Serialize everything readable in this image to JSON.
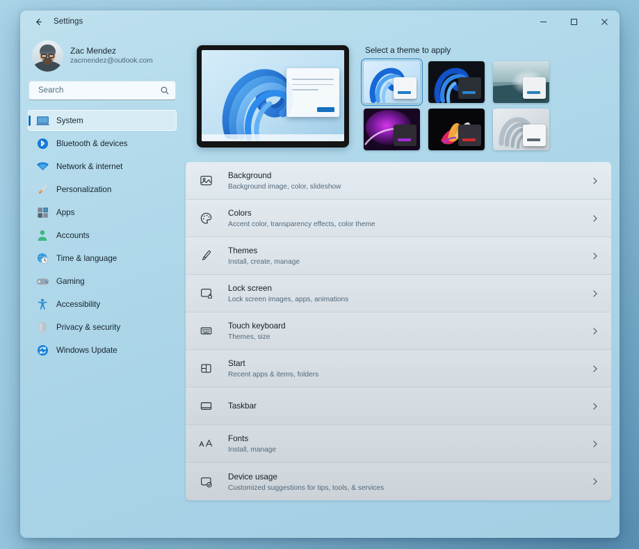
{
  "window": {
    "title": "Settings",
    "back_icon": "back-arrow-icon",
    "minimize_label": "—",
    "maximize_label": "□",
    "close_label": "✕"
  },
  "account": {
    "name": "Zac Mendez",
    "email": "zacmendez@outlook.com",
    "avatar_icon": "user-avatar-photo"
  },
  "search": {
    "placeholder": "Search",
    "value": "",
    "icon": "search-icon"
  },
  "sidebar": {
    "items": [
      {
        "label": "System",
        "icon": "system-monitor-icon",
        "selected": true
      },
      {
        "label": "Bluetooth & devices",
        "icon": "bluetooth-icon",
        "selected": false
      },
      {
        "label": "Network & internet",
        "icon": "wifi-icon",
        "selected": false
      },
      {
        "label": "Personalization",
        "icon": "paintbrush-icon",
        "selected": false
      },
      {
        "label": "Apps",
        "icon": "apps-grid-icon",
        "selected": false
      },
      {
        "label": "Accounts",
        "icon": "account-person-icon",
        "selected": false
      },
      {
        "label": "Time & language",
        "icon": "clock-globe-icon",
        "selected": false
      },
      {
        "label": "Gaming",
        "icon": "gamepad-icon",
        "selected": false
      },
      {
        "label": "Accessibility",
        "icon": "accessibility-person-icon",
        "selected": false
      },
      {
        "label": "Privacy & security",
        "icon": "shield-icon",
        "selected": false
      },
      {
        "label": "Windows Update",
        "icon": "update-refresh-icon",
        "selected": false
      }
    ]
  },
  "preview": {
    "device_icon": "monitor-preview",
    "wallpaper": "windows-bloom-blue",
    "mock_window_accent": "#1570bf"
  },
  "themes": {
    "title": "Select a theme to apply",
    "items": [
      {
        "name": "Windows light bloom",
        "selected": true,
        "window_fill": "#f2f6f9",
        "accent": "#1f7dc4"
      },
      {
        "name": "Windows dark bloom",
        "selected": false,
        "window_fill": "#2b2f36",
        "accent": "#2a84cc"
      },
      {
        "name": "Glow sunrise",
        "selected": false,
        "window_fill": "#eef2f3",
        "accent": "#2a7fb8"
      },
      {
        "name": "Captured motion purple",
        "selected": false,
        "window_fill": "#2e2b33",
        "accent": "#a32dd6"
      },
      {
        "name": "Flow floral dark",
        "selected": false,
        "window_fill": "#34313a",
        "accent": "#d42a32"
      },
      {
        "name": "Flow light",
        "selected": false,
        "window_fill": "#f4f6f7",
        "accent": "#5d666d"
      }
    ]
  },
  "settings_list": [
    {
      "title": "Background",
      "subtitle": "Background image, color, slideshow",
      "icon": "picture-icon"
    },
    {
      "title": "Colors",
      "subtitle": "Accent color, transparency effects, color theme",
      "icon": "palette-icon"
    },
    {
      "title": "Themes",
      "subtitle": "Install, create, manage",
      "icon": "brush-icon"
    },
    {
      "title": "Lock screen",
      "subtitle": "Lock screen images, apps, animations",
      "icon": "lock-screen-icon"
    },
    {
      "title": "Touch keyboard",
      "subtitle": "Themes, size",
      "icon": "keyboard-icon"
    },
    {
      "title": "Start",
      "subtitle": "Recent apps & items, folders",
      "icon": "start-grid-icon"
    },
    {
      "title": "Taskbar",
      "subtitle": "",
      "icon": "taskbar-icon"
    },
    {
      "title": "Fonts",
      "subtitle": "Install, manage",
      "icon": "fonts-aa-icon"
    },
    {
      "title": "Device usage",
      "subtitle": "Customized suggestions for tips, tools, & services",
      "icon": "device-usage-icon"
    }
  ],
  "colors": {
    "accent": "#0f6cbd",
    "selection_border": "#2f84c9",
    "desktop": "#8bbfd8"
  }
}
